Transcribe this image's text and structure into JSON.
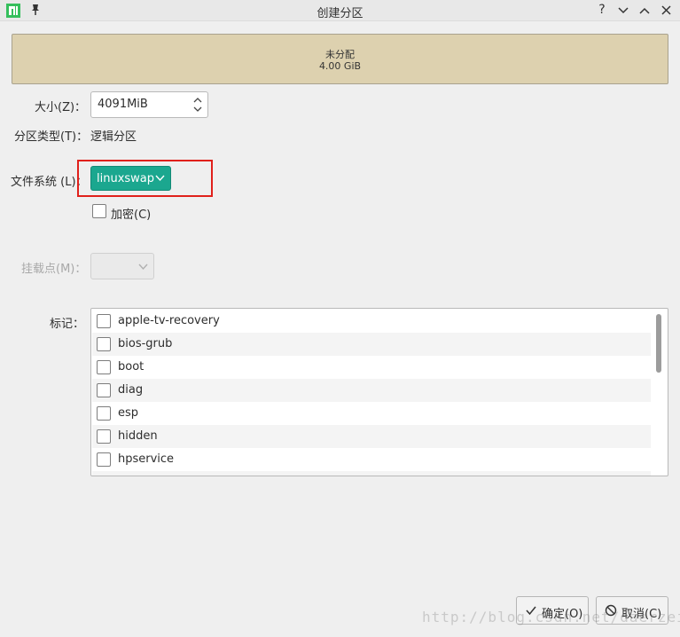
{
  "window": {
    "title": "创建分区",
    "help_label": "?",
    "colors": {
      "accent": "#1ba78f",
      "partition": "#ddd1af",
      "highlight_box": "#e0201b",
      "logo": "#35bf5c"
    }
  },
  "partition": {
    "name": "未分配",
    "size": "4.00 GiB"
  },
  "form": {
    "size_label": "大小(Z)：",
    "size_value": "4091MiB",
    "type_label": "分区类型(T)：",
    "type_value": "逻辑分区",
    "fs_label": "文件系统 (L)：",
    "fs_value": "linuxswap",
    "encrypt_label": "加密(C)",
    "encrypt_checked": false,
    "mount_label": "挂载点(M)：",
    "mount_value": "",
    "flags_label": "标记："
  },
  "flags": [
    {
      "label": "apple-tv-recovery",
      "checked": false
    },
    {
      "label": "bios-grub",
      "checked": false
    },
    {
      "label": "boot",
      "checked": false
    },
    {
      "label": "diag",
      "checked": false
    },
    {
      "label": "esp",
      "checked": false
    },
    {
      "label": "hidden",
      "checked": false
    },
    {
      "label": "hpservice",
      "checked": false
    }
  ],
  "buttons": {
    "ok": "确定(O)",
    "cancel": "取消(C)"
  },
  "watermark": "http://blog.csdn.net/daerzei"
}
